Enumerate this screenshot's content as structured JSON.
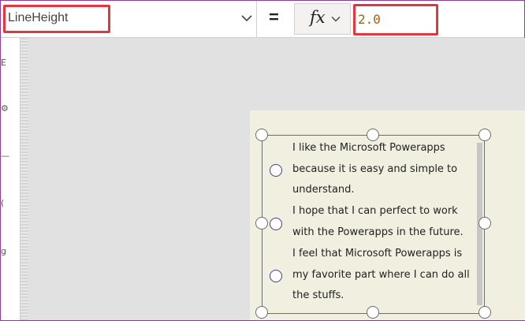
{
  "formula_bar": {
    "property_name": "LineHeight",
    "equals": "=",
    "fx_label": "fx",
    "formula_value": "2.0"
  },
  "left_rail": {
    "marks": [
      "E",
      "⚙",
      "—",
      "(",
      "g"
    ]
  },
  "radio": {
    "options": [
      {
        "lines": [
          "I like the Microsoft Powerapps",
          "because it is easy and simple to",
          "understand."
        ]
      },
      {
        "lines": [
          "I hope that I can perfect to work",
          "with the Powerapps in the future."
        ]
      },
      {
        "lines": [
          "I feel that Microsoft Powerapps is",
          "my favorite part where I can do all",
          "the stuffs."
        ]
      }
    ]
  },
  "colors": {
    "highlight": "#e0383e",
    "formula_value": "#b25c00",
    "screen_fill": "#f1efe0",
    "radio_circle": "#4a3b8c"
  }
}
